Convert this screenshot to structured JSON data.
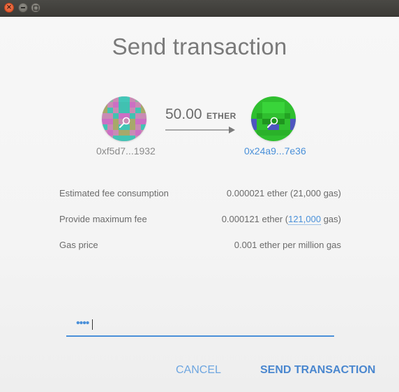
{
  "dialog": {
    "title": "Send transaction"
  },
  "from": {
    "address": "0xf5d7...1932",
    "avatar_icon": "identicon-pink-teal"
  },
  "to": {
    "address": "0x24a9...7e36",
    "avatar_icon": "identicon-green"
  },
  "amount": {
    "value": "50.00",
    "unit": "ETHER"
  },
  "fees": {
    "estimated_label": "Estimated fee consumption",
    "estimated_value": "0.000021 ether (21,000 gas)",
    "max_label": "Provide maximum fee",
    "max_value_prefix": "0.000121 ether (",
    "max_gas_link": "121,000",
    "max_value_suffix": " gas)",
    "gas_price_label": "Gas price",
    "gas_price_value": "0.001 ether per million gas"
  },
  "password": {
    "masked_value": "••••"
  },
  "buttons": {
    "cancel": "CANCEL",
    "send": "SEND TRANSACTION"
  },
  "colors": {
    "accent": "#4a90d9",
    "text": "#6b6b6b",
    "close": "#e0542a"
  }
}
